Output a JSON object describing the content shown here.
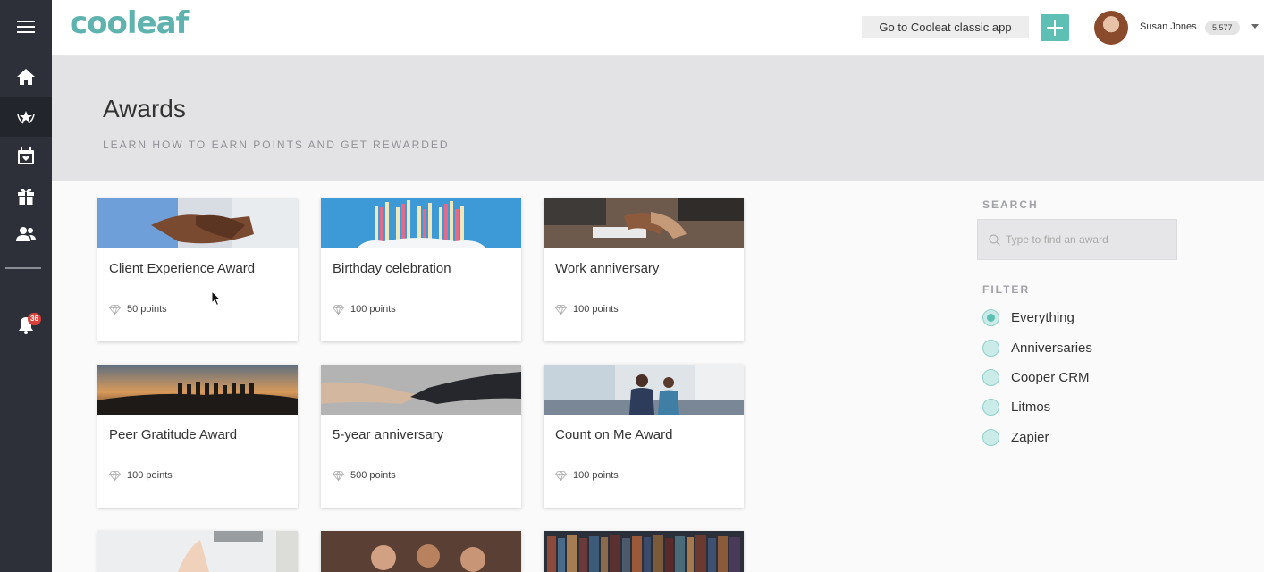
{
  "app": {
    "logo": "cooleaf"
  },
  "topbar": {
    "classic_button": "Go to Cooleat classic app",
    "user_name": "Susan Jones",
    "user_points": "5,577"
  },
  "sidebar": {
    "notification_count": "36"
  },
  "header": {
    "title": "Awards",
    "subtitle": "LEARN HOW TO EARN POINTS AND GET REWARDED"
  },
  "awards": [
    {
      "title": "Client Experience Award",
      "points": "50 points",
      "image": "handshake"
    },
    {
      "title": "Birthday celebration",
      "points": "100 points",
      "image": "birthday-candles"
    },
    {
      "title": "Work anniversary",
      "points": "100 points",
      "image": "meeting-table"
    },
    {
      "title": "Peer Gratitude Award",
      "points": "100 points",
      "image": "sunset-group"
    },
    {
      "title": "5-year anniversary",
      "points": "500 points",
      "image": "business-handshake"
    },
    {
      "title": "Count on Me Award",
      "points": "100 points",
      "image": "office-colleagues"
    },
    {
      "title": "",
      "points": "",
      "image": "laptop-desk"
    },
    {
      "title": "",
      "points": "",
      "image": "smiling-friends"
    },
    {
      "title": "",
      "points": "",
      "image": "bookshelf"
    }
  ],
  "search": {
    "label": "SEARCH",
    "placeholder": "Type to find an award"
  },
  "filter": {
    "label": "FILTER",
    "options": [
      {
        "label": "Everything",
        "selected": true
      },
      {
        "label": "Anniversaries",
        "selected": false
      },
      {
        "label": "Cooper CRM",
        "selected": false
      },
      {
        "label": "Litmos",
        "selected": false
      },
      {
        "label": "Zapier",
        "selected": false
      }
    ]
  },
  "colors": {
    "accent": "#5ec0b4",
    "sidebar": "#2d3039",
    "header_band": "#e3e3e5"
  }
}
